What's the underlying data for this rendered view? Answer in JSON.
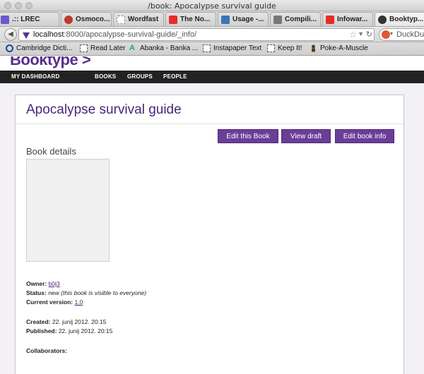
{
  "window": {
    "title": "/book: Apocalypse survival guide"
  },
  "tabs": [
    {
      "label": ".:: LREC",
      "icon_color": "#6a5acd"
    },
    {
      "label": "Osmoco...",
      "icon_color": "#c0392b"
    },
    {
      "label": "Wordfast",
      "icon_color": "#cccccc"
    },
    {
      "label": "The No...",
      "icon_color": "#e52d27"
    },
    {
      "label": "Usage -...",
      "icon_color": "#3a76b5"
    },
    {
      "label": "Compili...",
      "icon_color": "#777777"
    },
    {
      "label": "Infowar...",
      "icon_color": "#e52d27"
    },
    {
      "label": "Booktyp...",
      "icon_color": "#333333"
    }
  ],
  "urlbar": {
    "host": "localhost",
    "path": ":8000/apocalypse-survival-guide/_info/"
  },
  "search": {
    "label": "DuckDuck"
  },
  "bookmarks": [
    {
      "label": "Cambridge Dicti...",
      "icon": "cambridge-icon"
    },
    {
      "label": "Read Later",
      "icon": "bookmark-page-icon"
    },
    {
      "label": "Abanka - Banka ...",
      "icon": "abanka-icon"
    },
    {
      "label": "Instapaper Text",
      "icon": "bookmark-page-icon"
    },
    {
      "label": "Keep It!",
      "icon": "bookmark-page-icon"
    },
    {
      "label": "Poke-A-Muscle",
      "icon": "muscle-icon"
    }
  ],
  "site": {
    "logo": "Booktype >",
    "nav": [
      "MY DASHBOARD",
      "BOOKS",
      "GROUPS",
      "PEOPLE"
    ]
  },
  "book": {
    "title": "Apocalypse survival guide",
    "buttons": {
      "edit": "Edit this Book",
      "draft": "View draft",
      "info": "Edit book info"
    },
    "details_heading": "Book details",
    "owner_label": "Owner:",
    "owner": "b0j3",
    "status_label": "Status:",
    "status": "new",
    "status_note": "(this book is visible to everyone)",
    "version_label": "Current version:",
    "version": "1.0",
    "created_label": "Created:",
    "created": "22. junij 2012. 20:15",
    "published_label": "Published:",
    "published": "22. junij 2012. 20:15",
    "collaborators_label": "Collaborators:"
  },
  "colors": {
    "brand": "#5b2f8c",
    "button": "#6a3d97",
    "nav_bg": "#222222"
  }
}
